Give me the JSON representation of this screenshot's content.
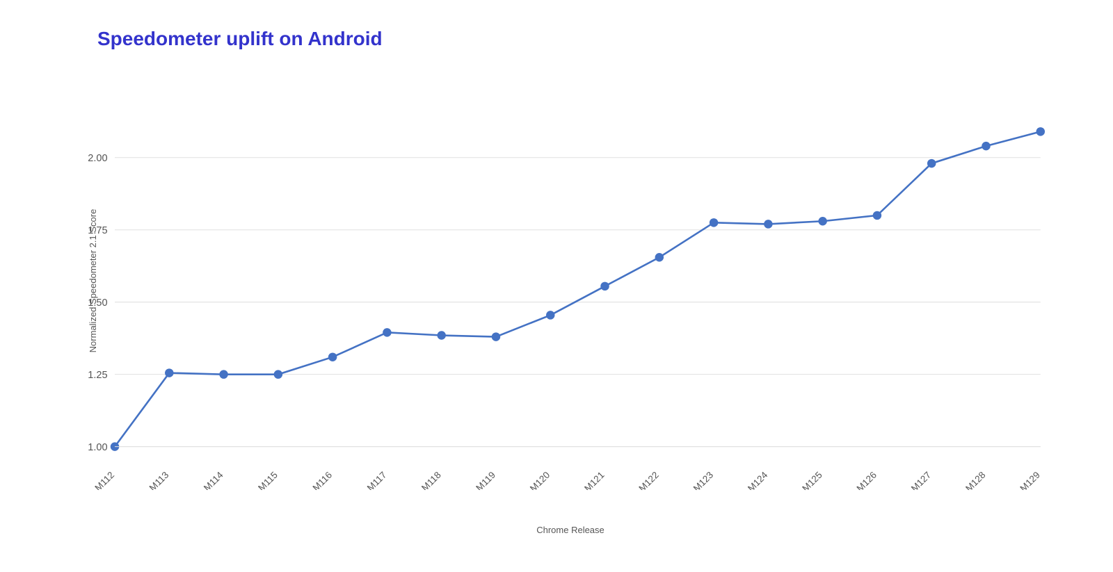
{
  "title": "Speedometer uplift on Android",
  "yAxisLabel": "Normalized Speedometer 2.1 Score",
  "xAxisLabel": "Chrome Release",
  "colors": {
    "line": "#4472C4",
    "dot": "#4472C4",
    "gridLine": "#e0e0e0",
    "axisText": "#555555",
    "title": "#3333cc"
  },
  "yAxis": {
    "min": 1.0,
    "max": 2.25,
    "ticks": [
      1.0,
      1.25,
      1.5,
      1.75,
      2.0
    ]
  },
  "dataPoints": [
    {
      "label": "M112",
      "value": 1.0
    },
    {
      "label": "M113",
      "value": 1.255
    },
    {
      "label": "M114",
      "value": 1.25
    },
    {
      "label": "M115",
      "value": 1.25
    },
    {
      "label": "M116",
      "value": 1.31
    },
    {
      "label": "M117",
      "value": 1.395
    },
    {
      "label": "M118",
      "value": 1.385
    },
    {
      "label": "M119",
      "value": 1.38
    },
    {
      "label": "M120",
      "value": 1.455
    },
    {
      "label": "M121",
      "value": 1.555
    },
    {
      "label": "M122",
      "value": 1.655
    },
    {
      "label": "M123",
      "value": 1.775
    },
    {
      "label": "M124",
      "value": 1.77
    },
    {
      "label": "M125",
      "value": 1.78
    },
    {
      "label": "M126",
      "value": 1.8
    },
    {
      "label": "M127",
      "value": 1.98
    },
    {
      "label": "M128",
      "value": 2.04
    },
    {
      "label": "M129",
      "value": 2.09
    }
  ]
}
